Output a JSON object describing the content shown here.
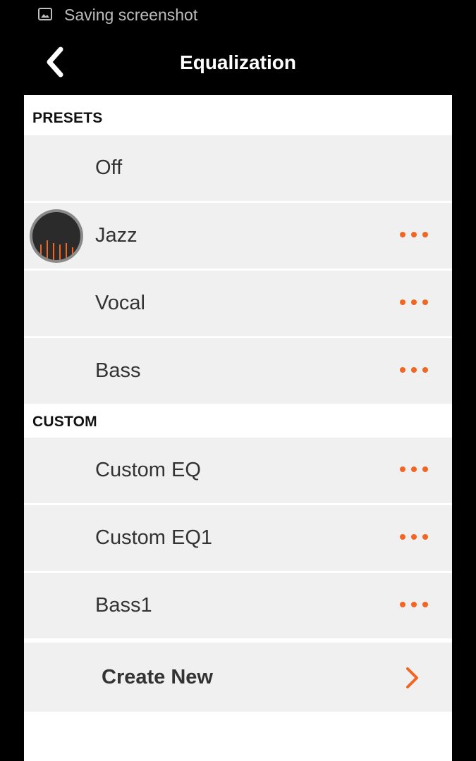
{
  "status_bar": {
    "icon": "image-icon",
    "text": "Saving screenshot"
  },
  "app_bar": {
    "back_icon": "chevron-left-icon",
    "title": "Equalization"
  },
  "presets": {
    "header": "PRESETS",
    "items": [
      {
        "label": "Off",
        "has_more": false,
        "selected": false
      },
      {
        "label": "Jazz",
        "has_more": true,
        "selected": true
      },
      {
        "label": "Vocal",
        "has_more": true,
        "selected": false
      },
      {
        "label": "Bass",
        "has_more": true,
        "selected": false
      }
    ]
  },
  "custom": {
    "header": "CUSTOM",
    "items": [
      {
        "label": "Custom EQ",
        "has_more": true
      },
      {
        "label": "Custom EQ1",
        "has_more": true
      },
      {
        "label": "Bass1",
        "has_more": true
      }
    ]
  },
  "create_new": {
    "label": "Create New",
    "icon": "chevron-right-icon"
  },
  "colors": {
    "accent": "#f26522",
    "background": "#000000",
    "row_background": "#f0f0f0",
    "panel_background": "#ffffff"
  }
}
